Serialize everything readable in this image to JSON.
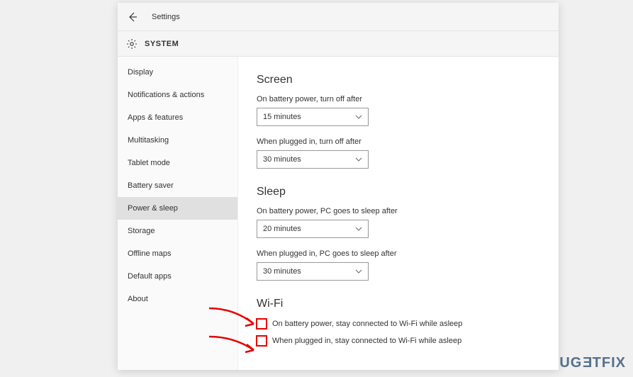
{
  "header": {
    "title": "Settings"
  },
  "subheader": {
    "title": "SYSTEM"
  },
  "sidebar": {
    "items": [
      {
        "label": "Display",
        "active": false
      },
      {
        "label": "Notifications & actions",
        "active": false
      },
      {
        "label": "Apps & features",
        "active": false
      },
      {
        "label": "Multitasking",
        "active": false
      },
      {
        "label": "Tablet mode",
        "active": false
      },
      {
        "label": "Battery saver",
        "active": false
      },
      {
        "label": "Power & sleep",
        "active": true
      },
      {
        "label": "Storage",
        "active": false
      },
      {
        "label": "Offline maps",
        "active": false
      },
      {
        "label": "Default apps",
        "active": false
      },
      {
        "label": "About",
        "active": false
      }
    ]
  },
  "content": {
    "screen": {
      "title": "Screen",
      "battery_label": "On battery power, turn off after",
      "battery_value": "15 minutes",
      "plugged_label": "When plugged in, turn off after",
      "plugged_value": "30 minutes"
    },
    "sleep": {
      "title": "Sleep",
      "battery_label": "On battery power, PC goes to sleep after",
      "battery_value": "20 minutes",
      "plugged_label": "When plugged in, PC goes to sleep after",
      "plugged_value": "30 minutes"
    },
    "wifi": {
      "title": "Wi-Fi",
      "battery_label": "On battery power, stay connected to Wi-Fi while asleep",
      "plugged_label": "When plugged in, stay connected to Wi-Fi while asleep"
    }
  },
  "watermark": "UG€TFIX"
}
